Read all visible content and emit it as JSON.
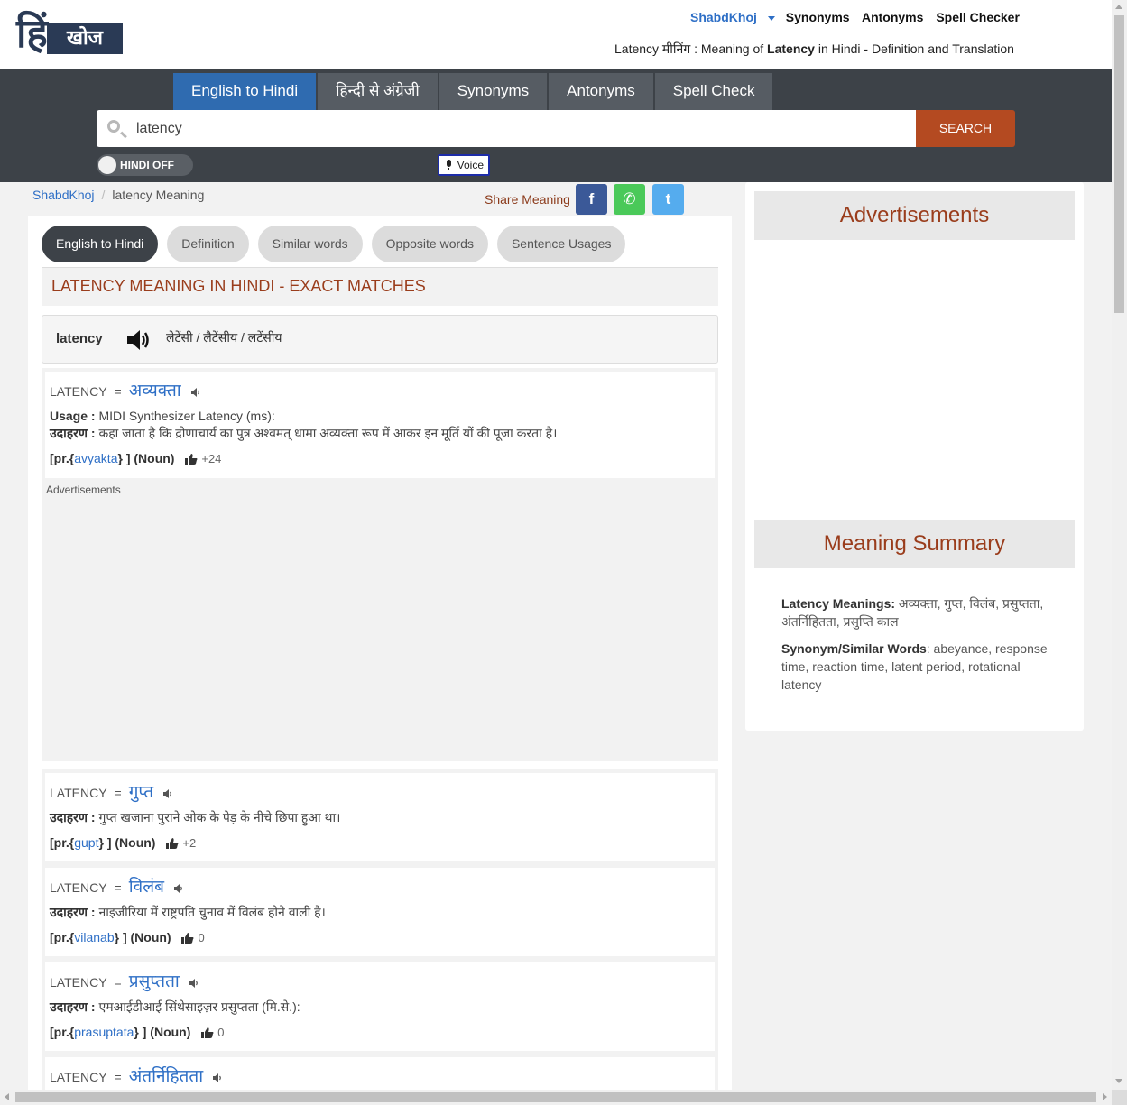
{
  "header": {
    "logo_mark": "हिं",
    "logo_word": "खोज",
    "nav": {
      "brand": "ShabdKhoj",
      "synonyms": "Synonyms",
      "antonyms": "Antonyms",
      "spell_checker": "Spell Checker"
    },
    "subtitle": {
      "prefix": "Latency मीनिंग : Meaning of ",
      "word": "Latency",
      "suffix": " in Hindi - Definition and Translation"
    }
  },
  "search": {
    "tabs": [
      "English to Hindi",
      "हिन्दी से अंग्रेजी",
      "Synonyms",
      "Antonyms",
      "Spell Check"
    ],
    "active_tab": 0,
    "query": "latency",
    "button": "SEARCH",
    "toggle": "HINDI OFF",
    "voice": "Voice"
  },
  "breadcrumb": {
    "home": "ShabdKhoj",
    "current": "latency Meaning"
  },
  "share": {
    "label": "Share Meaning",
    "fb": "f",
    "wa": "✆",
    "tw": "t"
  },
  "content_tabs": [
    "English to Hindi",
    "Definition",
    "Similar words",
    "Opposite words",
    "Sentence Usages"
  ],
  "section_title": "LATENCY MEANING IN HINDI - EXACT MATCHES",
  "word": {
    "text": "latency",
    "pronunciation": "लेटेंसी / लैटेंसीय / लटेंसीय"
  },
  "ad_label": "Advertisements",
  "labels": {
    "usage": "Usage :",
    "example": "उदाहरण :",
    "pr_open": "[pr.{",
    "pr_close": "} ]",
    "noun": "(Noun)"
  },
  "entries": [
    {
      "en": "LATENCY",
      "eq": "=",
      "hi": "अव्यक्ता",
      "usage": "MIDI Synthesizer Latency (ms):",
      "example": "कहा जाता है कि द्रोणाचार्य का पुत्र अश्वमत् धामा अव्यक्ता रूप में आकर इन मूर्ति यों की पूजा करता है।",
      "translit": "avyakta",
      "votes": "+24"
    },
    {
      "en": "LATENCY",
      "eq": "=",
      "hi": "गुप्त",
      "example": "गुप्त खजाना पुराने ओक के पेड़ के नीचे छिपा हुआ था।",
      "translit": "gupt",
      "votes": "+2"
    },
    {
      "en": "LATENCY",
      "eq": "=",
      "hi": "विलंब",
      "example": "नाइजीरिया में राष्ट्रपति चुनाव में विलंब होने वाली है।",
      "translit": "vilanab",
      "votes": "0"
    },
    {
      "en": "LATENCY",
      "eq": "=",
      "hi": "प्रसुप्तता",
      "example": "एमआईडीआई सिंथेसाइज़र प्रसुप्तता (मि.से.):",
      "translit": "prasuptata",
      "votes": "0"
    },
    {
      "en": "LATENCY",
      "eq": "=",
      "hi": "अंतर्निहितता"
    }
  ],
  "sidebar": {
    "ads_title": "Advertisements",
    "summary_title": "Meaning Summary",
    "meanings_label": "Latency Meanings:",
    "meanings": " अव्यक्ता, गुप्त, विलंब, प्रसुप्तता, अंतर्निहितता, प्रसुप्ति काल",
    "synonyms_label": "Synonym/Similar Words",
    "synonyms": ": abeyance, response time, reaction time, latent period, rotational latency"
  }
}
